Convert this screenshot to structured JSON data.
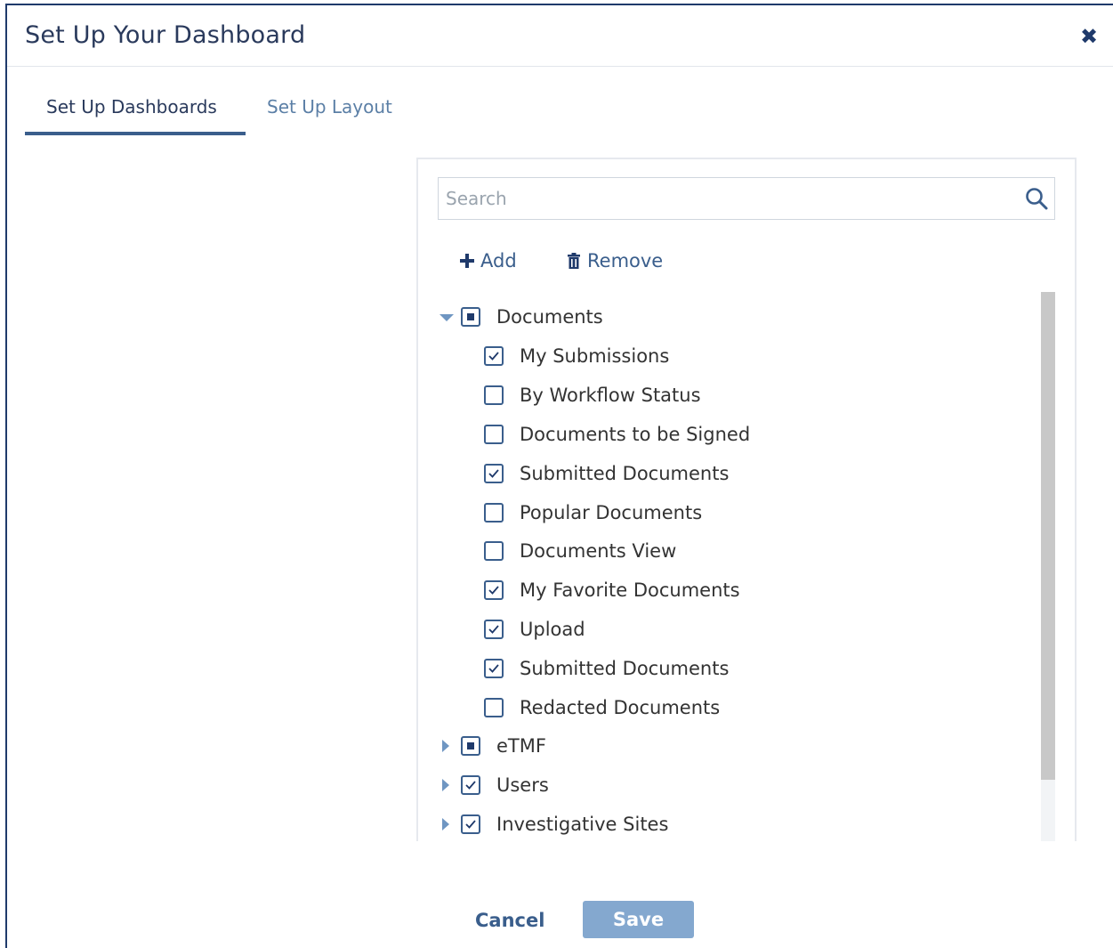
{
  "dialog": {
    "title": "Set Up Your Dashboard",
    "close_icon": "close-icon"
  },
  "tabs": [
    {
      "label": "Set Up Dashboards",
      "active": true
    },
    {
      "label": "Set Up Layout",
      "active": false
    }
  ],
  "search": {
    "placeholder": "Search",
    "value": "",
    "icon": "search-icon"
  },
  "actions": {
    "add_label": "Add",
    "add_icon": "plus-icon",
    "remove_label": "Remove",
    "remove_icon": "trash-icon"
  },
  "tree": {
    "groups": [
      {
        "label": "Documents",
        "expanded": true,
        "state": "partial",
        "children": [
          {
            "label": "My Submissions",
            "checked": true
          },
          {
            "label": "By Workflow Status",
            "checked": false
          },
          {
            "label": "Documents to be Signed",
            "checked": false
          },
          {
            "label": "Submitted Documents",
            "checked": true
          },
          {
            "label": "Popular Documents",
            "checked": false
          },
          {
            "label": "Documents View",
            "checked": false
          },
          {
            "label": "My Favorite Documents",
            "checked": true
          },
          {
            "label": "Upload",
            "checked": true
          },
          {
            "label": "Submitted Documents",
            "checked": true
          },
          {
            "label": "Redacted Documents",
            "checked": false
          }
        ]
      },
      {
        "label": "eTMF",
        "expanded": false,
        "state": "partial"
      },
      {
        "label": "Users",
        "expanded": false,
        "state": "checked"
      },
      {
        "label": "Investigative Sites",
        "expanded": false,
        "state": "checked"
      }
    ]
  },
  "footer": {
    "cancel_label": "Cancel",
    "save_label": "Save"
  },
  "colors": {
    "accent": "#1f3a6b",
    "link": "#3a5e8c",
    "save_button": "#84a8cf"
  }
}
